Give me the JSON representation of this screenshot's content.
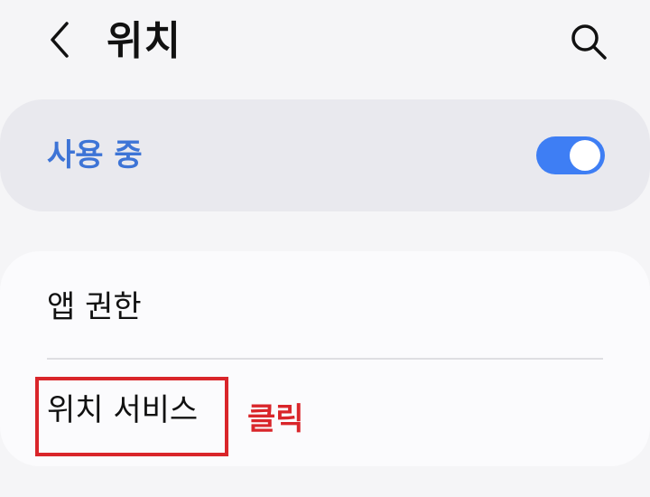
{
  "header": {
    "title": "위치",
    "back_icon": "chevron-left-icon",
    "search_icon": "search-icon"
  },
  "toggle": {
    "label": "사용 중",
    "state": "on",
    "accent_color": "#3e7ef4",
    "label_color": "#3d74d6"
  },
  "list": {
    "items": [
      {
        "label": "앱 권한"
      },
      {
        "label": "위치 서비스"
      }
    ]
  },
  "annotation": {
    "text": "클릭",
    "color": "#d9252a"
  }
}
